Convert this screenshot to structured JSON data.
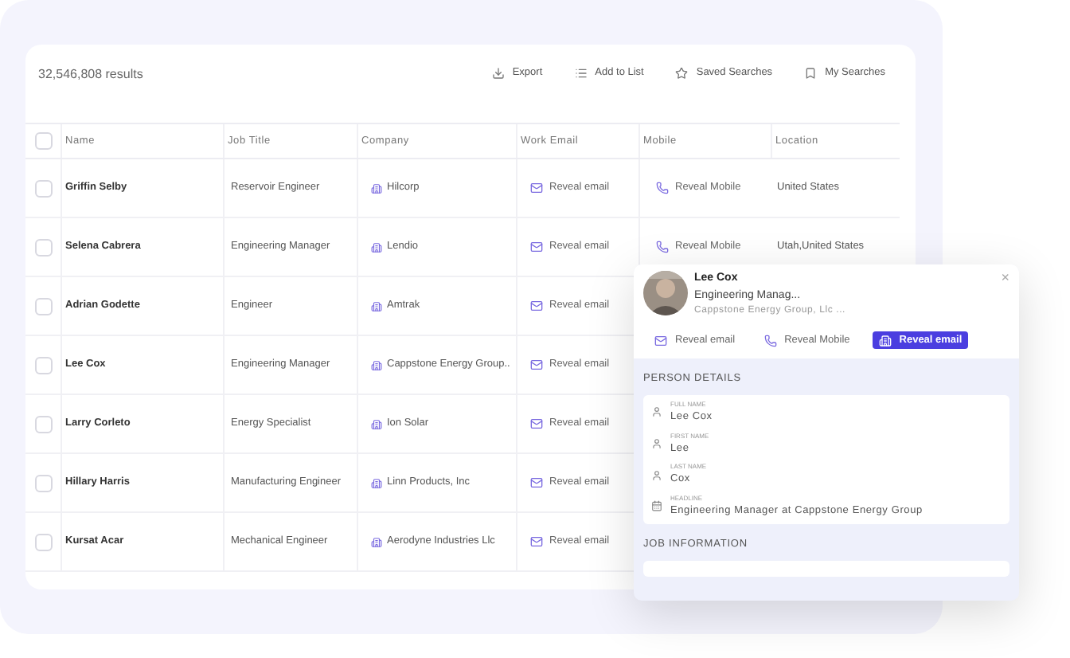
{
  "results": "32,546,808 results",
  "toolbar": [
    {
      "kind": "export",
      "label": "Export"
    },
    {
      "kind": "list",
      "label": "Add to List"
    },
    {
      "kind": "star",
      "label": "Saved Searches"
    },
    {
      "kind": "bookmark",
      "label": "My Searches"
    }
  ],
  "table": {
    "all_checked": false,
    "columns": [
      "Name",
      "Job Title",
      "Company",
      "Work Email",
      "Mobile",
      "Location"
    ],
    "rows": [
      {
        "checked": false,
        "name": "Griffin Selby",
        "job_title": "Reservoir Engineer",
        "company": "Hilcorp",
        "work_email": "Reveal email",
        "mobile": "Reveal Mobile",
        "location": "United States"
      },
      {
        "checked": false,
        "name": "Selena Cabrera",
        "job_title": "Engineering Manager",
        "company": "Lendio",
        "work_email": "Reveal email",
        "mobile": "Reveal Mobile",
        "location": "Utah,United States"
      },
      {
        "checked": false,
        "name": "Adrian Godette",
        "job_title": "Engineer",
        "company": "Amtrak",
        "work_email": "Reveal email"
      },
      {
        "checked": false,
        "name": "Lee Cox",
        "job_title": "Engineering Manager",
        "company": "Cappstone Energy Group..",
        "work_email": "Reveal email"
      },
      {
        "checked": false,
        "name": "Larry Corleto",
        "job_title": "Energy Specialist",
        "company": "Ion Solar",
        "work_email": "Reveal email"
      },
      {
        "checked": false,
        "name": "Hillary Harris",
        "job_title": "Manufacturing Engineer",
        "company": "Linn Products, Inc",
        "work_email": "Reveal email"
      },
      {
        "checked": false,
        "name": "Kursat Acar",
        "job_title": "Mechanical Engineer",
        "company": "Aerodyne Industries Llc",
        "work_email": "Reveal email"
      }
    ]
  },
  "popup": {
    "name": "Lee Cox",
    "title": "Engineering Manag...",
    "company": "Cappstone Energy Group, Llc ...",
    "close": "×",
    "actions": [
      {
        "kind": "mail",
        "label": "Reveal email",
        "primary": false
      },
      {
        "kind": "phone",
        "label": "Reveal Mobile",
        "primary": false
      },
      {
        "kind": "building",
        "label": "Reveal email",
        "primary": true
      }
    ],
    "sections": [
      {
        "title": "PERSON DETAILS",
        "fields": [
          {
            "kind": "person",
            "label": "FULL NAME",
            "value": "Lee Cox"
          },
          {
            "kind": "person",
            "label": "FIRST NAME",
            "value": "Lee"
          },
          {
            "kind": "person",
            "label": "LAST NAME",
            "value": "Cox"
          },
          {
            "kind": "calendar",
            "label": "HEADLINE",
            "value": "Engineering Manager at Cappstone Energy Group"
          }
        ]
      },
      {
        "title": "JOB INFORMATION"
      }
    ]
  }
}
